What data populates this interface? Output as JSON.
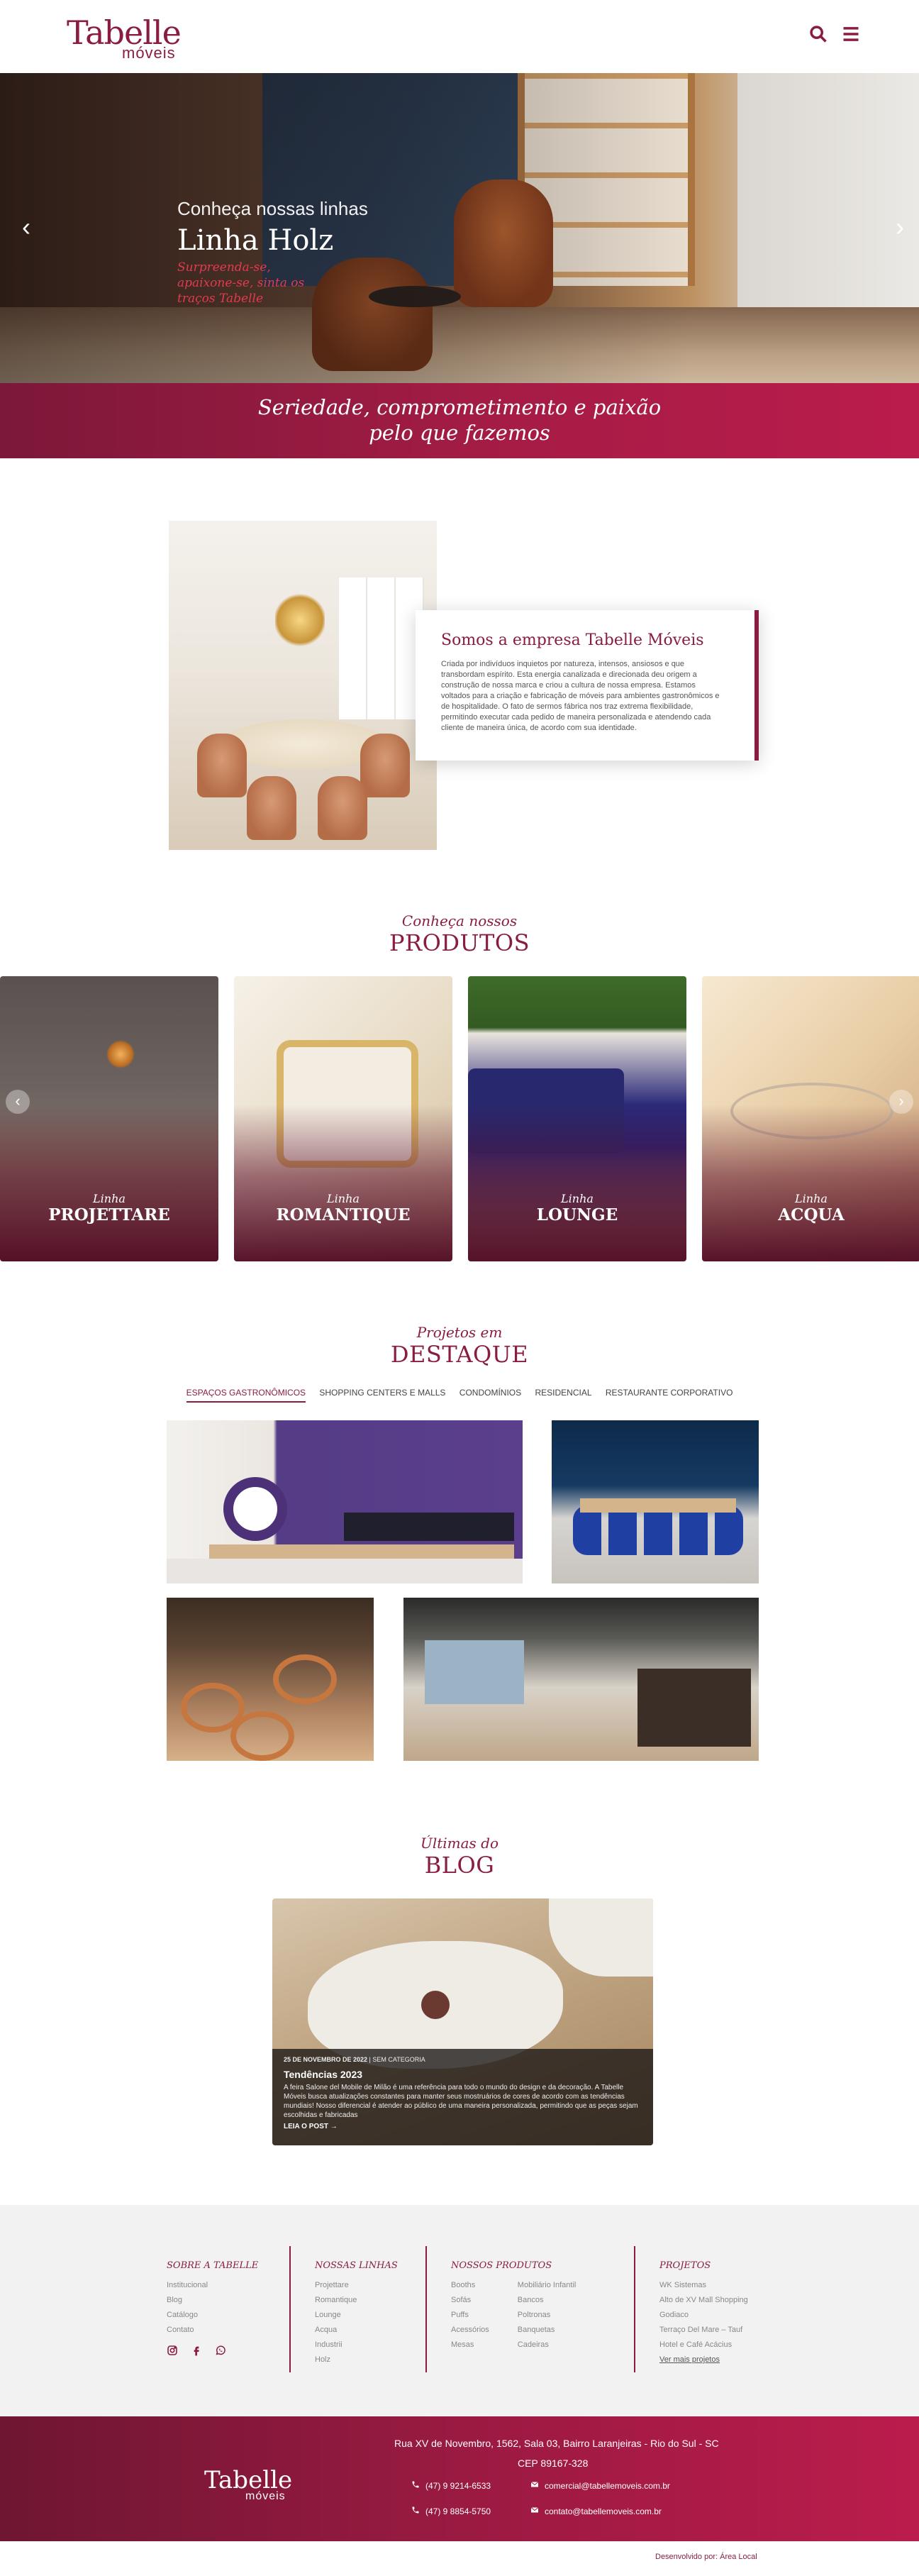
{
  "header": {
    "logo_main": "Tabelle",
    "logo_sub": "móveis",
    "search_icon": "search-icon",
    "menu_icon": "menu-icon"
  },
  "hero": {
    "pre": "Conheça nossas linhas",
    "title": "Linha Holz",
    "subtitle": "Surpreenda-se, apaixone-se, sinta os traços Tabelle",
    "prev": "‹",
    "next": "›"
  },
  "tagline": {
    "line1": "Seriedade, comprometimento e paixão",
    "line2": "pelo que fazemos"
  },
  "about": {
    "title": "Somos a empresa Tabelle Móveis",
    "body": "Criada por indivíduos inquietos por natureza, intensos, ansiosos e que transbordam espírito. Esta energia canalizada e direcionada deu origem a construção de nossa marca e criou a cultura de nossa empresa. Estamos voltados para a criação e fabricação de móveis para ambientes gastronômicos e de hospitalidade. O fato de sermos fábrica nos traz extrema flexibilidade, permitindo executar cada pedido de maneira personalizada e atendendo cada cliente de maneira única, de acordo com sua identidade."
  },
  "products": {
    "pre": "Conheça nossos",
    "title": "PRODUTOS",
    "items": [
      {
        "pre": "Linha",
        "name": "PROJETTARE"
      },
      {
        "pre": "Linha",
        "name": "ROMANTIQUE"
      },
      {
        "pre": "Linha",
        "name": "LOUNGE"
      },
      {
        "pre": "Linha",
        "name": "ACQUA"
      }
    ],
    "prev": "‹",
    "next": "›"
  },
  "projects": {
    "pre": "Projetos em",
    "title": "DESTAQUE",
    "tabs": [
      "ESPAÇOS GASTRONÔMICOS",
      "SHOPPING CENTERS E MALLS",
      "CONDOMÍNIOS",
      "RESIDENCIAL",
      "RESTAURANTE CORPORATIVO"
    ],
    "active_tab": 0
  },
  "blog": {
    "pre": "Últimas do",
    "title": "BLOG",
    "post": {
      "date": "25 DE NOVEMBRO DE 2022",
      "category": "SEM CATEGORIA",
      "title": "Tendências 2023",
      "excerpt": "A feira Salone del Mobile de Milão é uma referência para todo o mundo do design e da decoração. A Tabelle Móveis busca atualizações constantes para manter seus mostruários de cores de acordo com as tendências mundiais! Nosso diferencial é atender ao público de uma maneira personalizada, permitindo que as peças sejam escolhidas e fabricadas",
      "link": "LEIA O POST"
    }
  },
  "footer": {
    "sobre": {
      "title": "SOBRE A TABELLE",
      "links": [
        "Institucional",
        "Blog",
        "Catálogo",
        "Contato"
      ]
    },
    "linhas": {
      "title": "NOSSAS LINHAS",
      "links": [
        "Projettare",
        "Romantique",
        "Lounge",
        "Acqua",
        "Industrii",
        "Holz"
      ]
    },
    "produtos": {
      "title": "NOSSOS PRODUTOS",
      "col1": [
        "Booths",
        "Sofás",
        "Puffs",
        "Acessórios",
        "Mesas"
      ],
      "col2": [
        "Mobiliário Infantil",
        "Bancos",
        "Poltronas",
        "Banquetas",
        "Cadeiras"
      ]
    },
    "projetos": {
      "title": "PROJETOS",
      "links": [
        "WK Sistemas",
        "Alto de XV Mall Shopping",
        "Godiaco",
        "Terraço Del Mare – Tauf",
        "Hotel e Café Acácius"
      ],
      "more": "Ver mais projetos"
    },
    "bottom": {
      "logo_main": "Tabelle",
      "logo_sub": "móveis",
      "address": "Rua XV de Novembro, 1562, Sala 03, Bairro Laranjeiras - Rio do Sul - SC",
      "cep": "CEP 89167-328",
      "phone1": "(47) 9 9214-6533",
      "phone2": "(47) 9 8854-5750",
      "email1": "comercial@tabellemoveis.com.br",
      "email2": "contato@tabellemoveis.com.br"
    },
    "credit": "Desenvolvido por: Área Local"
  }
}
